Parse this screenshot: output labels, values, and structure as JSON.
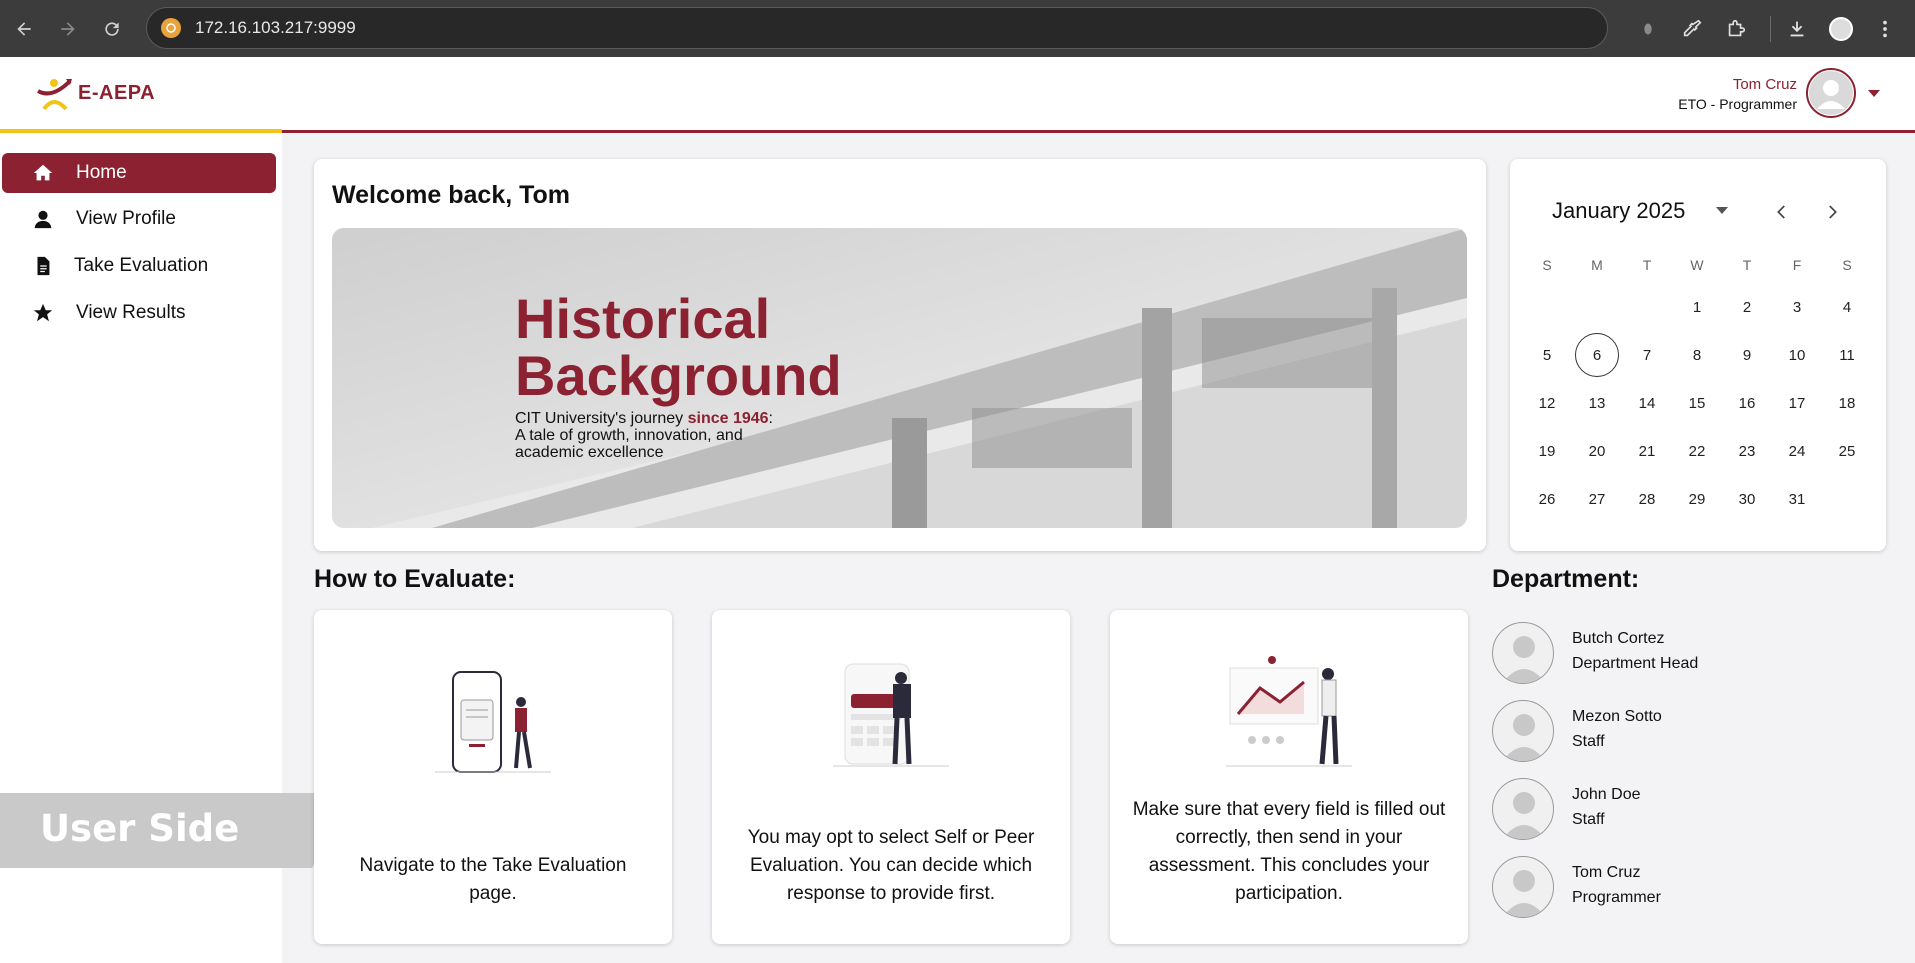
{
  "browser": {
    "url": "172.16.103.217:9999",
    "icons": [
      "back-icon",
      "forward-icon",
      "reload-icon",
      "site-info-icon",
      "bell-icon",
      "eyedropper-icon",
      "extensions-icon",
      "download-icon",
      "profile-icon",
      "more-icon"
    ]
  },
  "header": {
    "logo_text": "E-AEPA",
    "user_name": "Tom Cruz",
    "user_role": "ETO - Programmer",
    "accent_color": "#8b2131",
    "highlight_color": "#f2c418"
  },
  "sidebar": {
    "items": [
      {
        "label": "Home",
        "icon": "home-icon",
        "active": true
      },
      {
        "label": "View Profile",
        "icon": "user-icon",
        "active": false
      },
      {
        "label": "Take Evaluation",
        "icon": "document-icon",
        "active": false
      },
      {
        "label": "View Results",
        "icon": "star-icon",
        "active": false
      }
    ]
  },
  "watermark": "User Side",
  "welcome": {
    "title": "Welcome back, Tom",
    "banner_title_line1": "Historical",
    "banner_title_line2": "Background",
    "banner_sub_prefix": "CIT University's journey ",
    "banner_sub_accent": "since 1946",
    "banner_sub_colon": ":",
    "banner_sub_line2": "A tale of growth, innovation, and",
    "banner_sub_line3": "academic excellence"
  },
  "calendar": {
    "month_label": "January 2025",
    "weekdays": [
      "S",
      "M",
      "T",
      "W",
      "T",
      "F",
      "S"
    ],
    "today": 6,
    "weeks": [
      [
        "",
        "",
        "",
        "1",
        "2",
        "3",
        "4"
      ],
      [
        "5",
        "6",
        "7",
        "8",
        "9",
        "10",
        "11"
      ],
      [
        "12",
        "13",
        "14",
        "15",
        "16",
        "17",
        "18"
      ],
      [
        "19",
        "20",
        "21",
        "22",
        "23",
        "24",
        "25"
      ],
      [
        "26",
        "27",
        "28",
        "29",
        "30",
        "31",
        ""
      ]
    ]
  },
  "how_to": {
    "title": "How to Evaluate:",
    "steps": [
      {
        "text": "Navigate to the Take Evaluation page."
      },
      {
        "text": "You may opt to select Self or Peer Evaluation. You can decide which response to provide first."
      },
      {
        "text": "Make sure that every field is filled out correctly, then send in your assessment. This concludes your participation."
      }
    ]
  },
  "department": {
    "title": "Department:",
    "members": [
      {
        "name": "Butch Cortez",
        "role": "Department Head"
      },
      {
        "name": "Mezon Sotto",
        "role": "Staff"
      },
      {
        "name": "John Doe",
        "role": "Staff"
      },
      {
        "name": "Tom Cruz",
        "role": "Programmer"
      }
    ]
  }
}
